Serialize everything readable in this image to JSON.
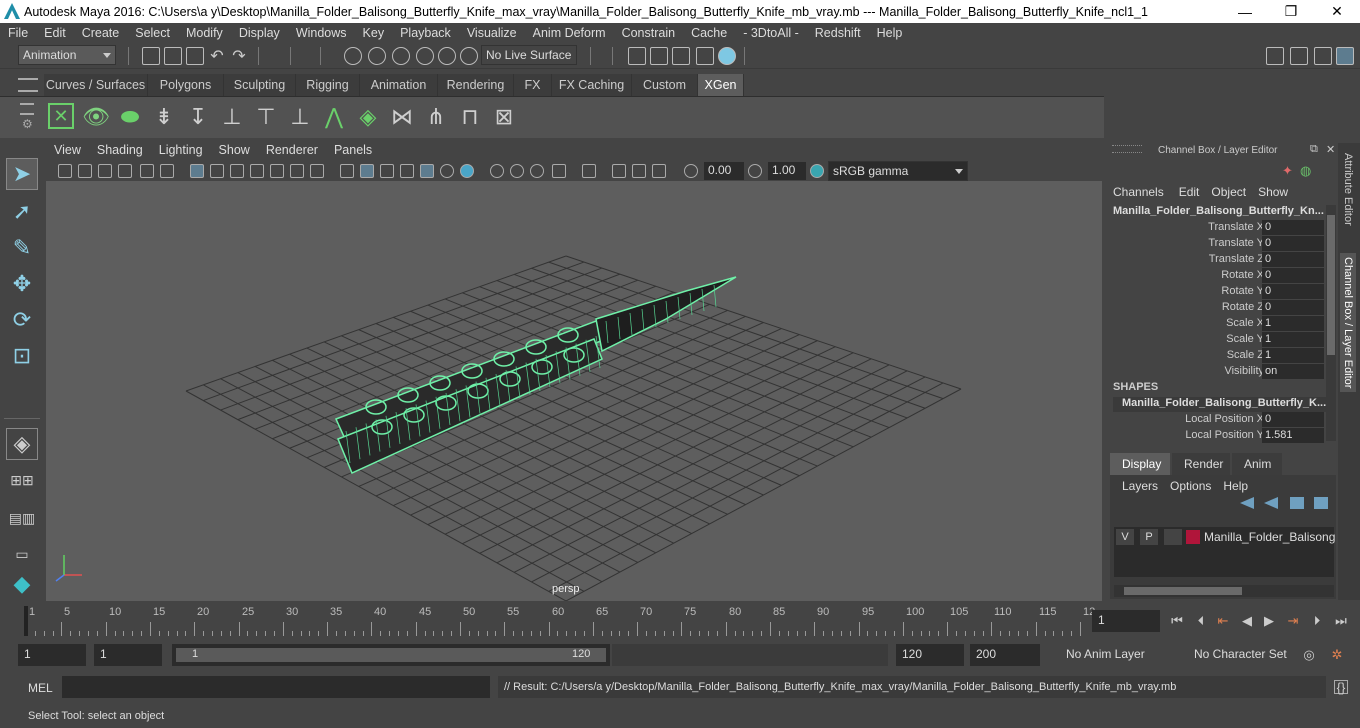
{
  "window": {
    "title": "Autodesk Maya 2016: C:\\Users\\a y\\Desktop\\Manilla_Folder_Balisong_Butterfly_Knife_max_vray\\Manilla_Folder_Balisong_Butterfly_Knife_mb_vray.mb   ---   Manilla_Folder_Balisong_Butterfly_Knife_ncl1_1",
    "minimize": "—",
    "maximize": "❐",
    "close": "✕"
  },
  "menu": [
    "File",
    "Edit",
    "Create",
    "Select",
    "Modify",
    "Display",
    "Windows",
    "Key",
    "Playback",
    "Visualize",
    "Anim Deform",
    "Constrain",
    "Cache",
    "- 3DtoAll -",
    "Redshift",
    "Help"
  ],
  "status": {
    "mode": "Animation",
    "live_surface": "No Live Surface"
  },
  "shelf_tabs": [
    "Curves / Surfaces",
    "Polygons",
    "Sculpting",
    "Rigging",
    "Animation",
    "Rendering",
    "FX",
    "FX Caching",
    "Custom",
    "XGen"
  ],
  "active_shelf_tab": "XGen",
  "panel_menu": [
    "View",
    "Shading",
    "Lighting",
    "Show",
    "Renderer",
    "Panels"
  ],
  "panel_toolbar": {
    "exposure": "0.00",
    "gamma": "1.00",
    "color_space": "sRGB gamma"
  },
  "viewport": {
    "camera": "persp"
  },
  "channel_box": {
    "title": "Channel Box / Layer Editor",
    "menu": [
      "Channels",
      "Edit",
      "Object",
      "Show"
    ],
    "object": "Manilla_Folder_Balisong_Butterfly_Kn...",
    "attributes": [
      {
        "label": "Translate X",
        "value": "0"
      },
      {
        "label": "Translate Y",
        "value": "0"
      },
      {
        "label": "Translate Z",
        "value": "0"
      },
      {
        "label": "Rotate X",
        "value": "0"
      },
      {
        "label": "Rotate Y",
        "value": "0"
      },
      {
        "label": "Rotate Z",
        "value": "0"
      },
      {
        "label": "Scale X",
        "value": "1"
      },
      {
        "label": "Scale Y",
        "value": "1"
      },
      {
        "label": "Scale Z",
        "value": "1"
      },
      {
        "label": "Visibility",
        "value": "on"
      }
    ],
    "shapes_header": "SHAPES",
    "shape_name": "Manilla_Folder_Balisong_Butterfly_K...",
    "shape_attributes": [
      {
        "label": "Local Position X",
        "value": "0"
      },
      {
        "label": "Local Position Y",
        "value": "1.581"
      }
    ]
  },
  "layer_editor": {
    "tabs": [
      "Display",
      "Render",
      "Anim"
    ],
    "active_tab": "Display",
    "menu": [
      "Layers",
      "Options",
      "Help"
    ],
    "layer": {
      "v": "V",
      "p": "P",
      "name": "Manilla_Folder_Balisong",
      "color": "#b0153a"
    }
  },
  "side_tabs": [
    "Attribute Editor",
    "Channel Box / Layer Editor"
  ],
  "timeline": {
    "ticks": [
      "1",
      "5",
      "10",
      "15",
      "20",
      "25",
      "30",
      "35",
      "40",
      "45",
      "50",
      "55",
      "60",
      "65",
      "70",
      "75",
      "80",
      "85",
      "90",
      "95",
      "100",
      "105",
      "110",
      "115",
      "12"
    ],
    "current_frame": "1"
  },
  "range": {
    "start": "1",
    "playback_start": "1",
    "slider_start": "1",
    "slider_end": "120",
    "playback_end": "120",
    "end": "200",
    "anim_layer": "No Anim Layer",
    "character_set": "No Character Set"
  },
  "command": {
    "lang": "MEL",
    "result": "// Result: C:/Users/a y/Desktop/Manilla_Folder_Balisong_Butterfly_Knife_max_vray/Manilla_Folder_Balisong_Butterfly_Knife_mb_vray.mb"
  },
  "help_line": "Select Tool: select an object"
}
